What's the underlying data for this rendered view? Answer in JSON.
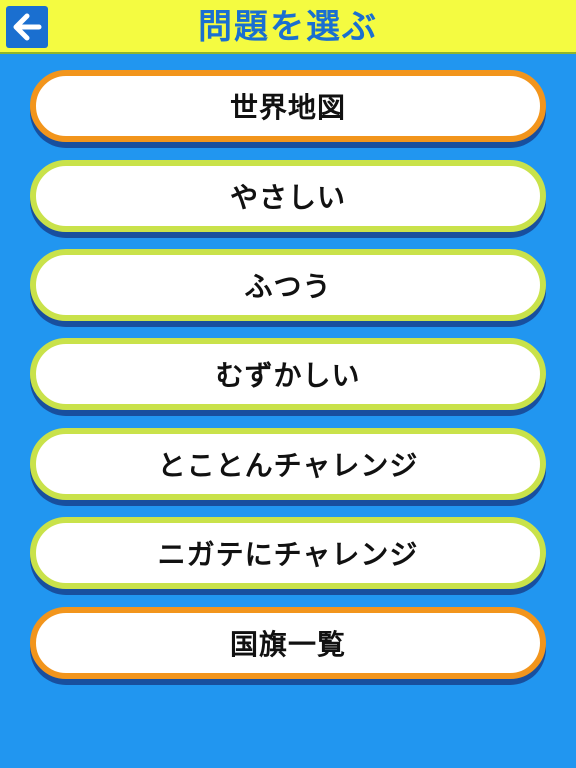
{
  "header": {
    "title": "問題を選ぶ",
    "back_icon": "arrow-left-icon"
  },
  "colors": {
    "background": "#2196f0",
    "header_bar": "#f4fb41",
    "title": "#1a6fd0",
    "accent_orange": "#f2951c",
    "accent_green": "#c9e24a"
  },
  "menu": {
    "items": [
      {
        "label": "世界地図",
        "style": "orange"
      },
      {
        "label": "やさしい",
        "style": "green"
      },
      {
        "label": "ふつう",
        "style": "green"
      },
      {
        "label": "むずかしい",
        "style": "green"
      },
      {
        "label": "とことんチャレンジ",
        "style": "green"
      },
      {
        "label": "ニガテにチャレンジ",
        "style": "green"
      },
      {
        "label": "国旗一覧",
        "style": "orange"
      }
    ]
  }
}
